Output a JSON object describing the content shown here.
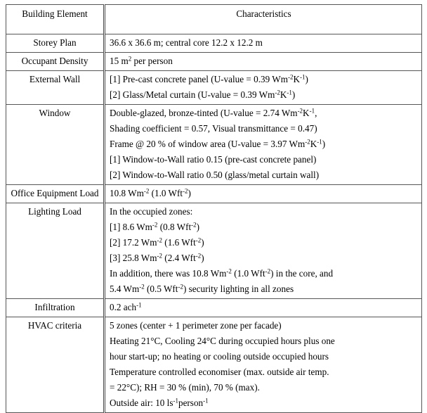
{
  "table": {
    "headers": {
      "element": "Building Element",
      "characteristics": "Characteristics"
    },
    "rows": [
      {
        "label": "Storey Plan",
        "lines": [
          [
            {
              "t": "36.6 x 36.6 m; central core 12.2 x 12.2 m"
            }
          ]
        ]
      },
      {
        "label": "Occupant Density",
        "lines": [
          [
            {
              "t": "15 m"
            },
            {
              "sup": "2"
            },
            {
              "t": " per person"
            }
          ]
        ]
      },
      {
        "label": "External Wall",
        "lines": [
          [
            {
              "t": "[1]  Pre-cast concrete panel (U-value = 0.39 Wm"
            },
            {
              "sup": "-2"
            },
            {
              "t": "K"
            },
            {
              "sup": "-1"
            },
            {
              "t": ")"
            }
          ],
          [
            {
              "t": "[2]  Glass/Metal curtain (U-value = 0.39 Wm"
            },
            {
              "sup": "-2"
            },
            {
              "t": "K"
            },
            {
              "sup": "-1"
            },
            {
              "t": ")"
            }
          ]
        ]
      },
      {
        "label": "Window",
        "lines": [
          [
            {
              "t": "Double-glazed, bronze-tinted (U-value = 2.74 Wm"
            },
            {
              "sup": "-2"
            },
            {
              "t": "K"
            },
            {
              "sup": "-1"
            },
            {
              "t": ","
            }
          ],
          [
            {
              "t": "Shading coefficient = 0.57, Visual transmittance = 0.47)"
            }
          ],
          [
            {
              "t": "Frame @ 20 % of window area (U-value = 3.97 Wm"
            },
            {
              "sup": "-2"
            },
            {
              "t": "K"
            },
            {
              "sup": "-1"
            },
            {
              "t": ")"
            }
          ],
          [
            {
              "t": "[1]  Window-to-Wall ratio 0.15 (pre-cast concrete panel)"
            }
          ],
          [
            {
              "t": "[2]  Window-to-Wall ratio 0.50 (glass/metal curtain wall)"
            }
          ]
        ]
      },
      {
        "label": "Office Equipment Load",
        "lines": [
          [
            {
              "t": "10.8 Wm"
            },
            {
              "sup": "-2"
            },
            {
              "t": " (1.0 Wft"
            },
            {
              "sup": "-2"
            },
            {
              "t": ")"
            }
          ]
        ]
      },
      {
        "label": "Lighting Load",
        "lines": [
          [
            {
              "t": "In the occupied zones:"
            }
          ],
          [
            {
              "t": "[1]  8.6 Wm"
            },
            {
              "sup": "-2"
            },
            {
              "t": " (0.8 Wft"
            },
            {
              "sup": "-2"
            },
            {
              "t": ")"
            }
          ],
          [
            {
              "t": "[2]  17.2 Wm"
            },
            {
              "sup": "-2"
            },
            {
              "t": " (1.6 Wft"
            },
            {
              "sup": "-2"
            },
            {
              "t": ")"
            }
          ],
          [
            {
              "t": "[3]  25.8 Wm"
            },
            {
              "sup": "-2"
            },
            {
              "t": " (2.4 Wft"
            },
            {
              "sup": "-2"
            },
            {
              "t": ")"
            }
          ],
          [
            {
              "t": "In addition, there was 10.8 Wm"
            },
            {
              "sup": "-2"
            },
            {
              "t": " (1.0 Wft"
            },
            {
              "sup": "-2"
            },
            {
              "t": ") in the core, and"
            }
          ],
          [
            {
              "t": "5.4 Wm"
            },
            {
              "sup": "-2"
            },
            {
              "t": " (0.5 Wft"
            },
            {
              "sup": "-2"
            },
            {
              "t": ") security lighting in all zones"
            }
          ]
        ]
      },
      {
        "label": "Infiltration",
        "lines": [
          [
            {
              "t": "0.2 ach"
            },
            {
              "sup": "-1"
            }
          ]
        ]
      },
      {
        "label": "HVAC criteria",
        "lines": [
          [
            {
              "t": "5 zones (center + 1 perimeter zone per facade)"
            }
          ],
          [
            {
              "t": "Heating 21°C, Cooling 24°C during occupied hours plus one"
            }
          ],
          [
            {
              "t": "hour start-up; no heating or cooling outside occupied hours"
            }
          ],
          [
            {
              "t": "Temperature controlled economiser (max. outside air temp."
            }
          ],
          [
            {
              "t": "= 22°C); RH = 30 % (min), 70 % (max)."
            }
          ],
          [
            {
              "t": "Outside air: 10 ls"
            },
            {
              "sup": "-1"
            },
            {
              "t": "person"
            },
            {
              "sup": "-1"
            }
          ]
        ]
      }
    ]
  },
  "style": {
    "border_color": "#565656",
    "text_color": "#000000",
    "background": "#ffffff"
  }
}
